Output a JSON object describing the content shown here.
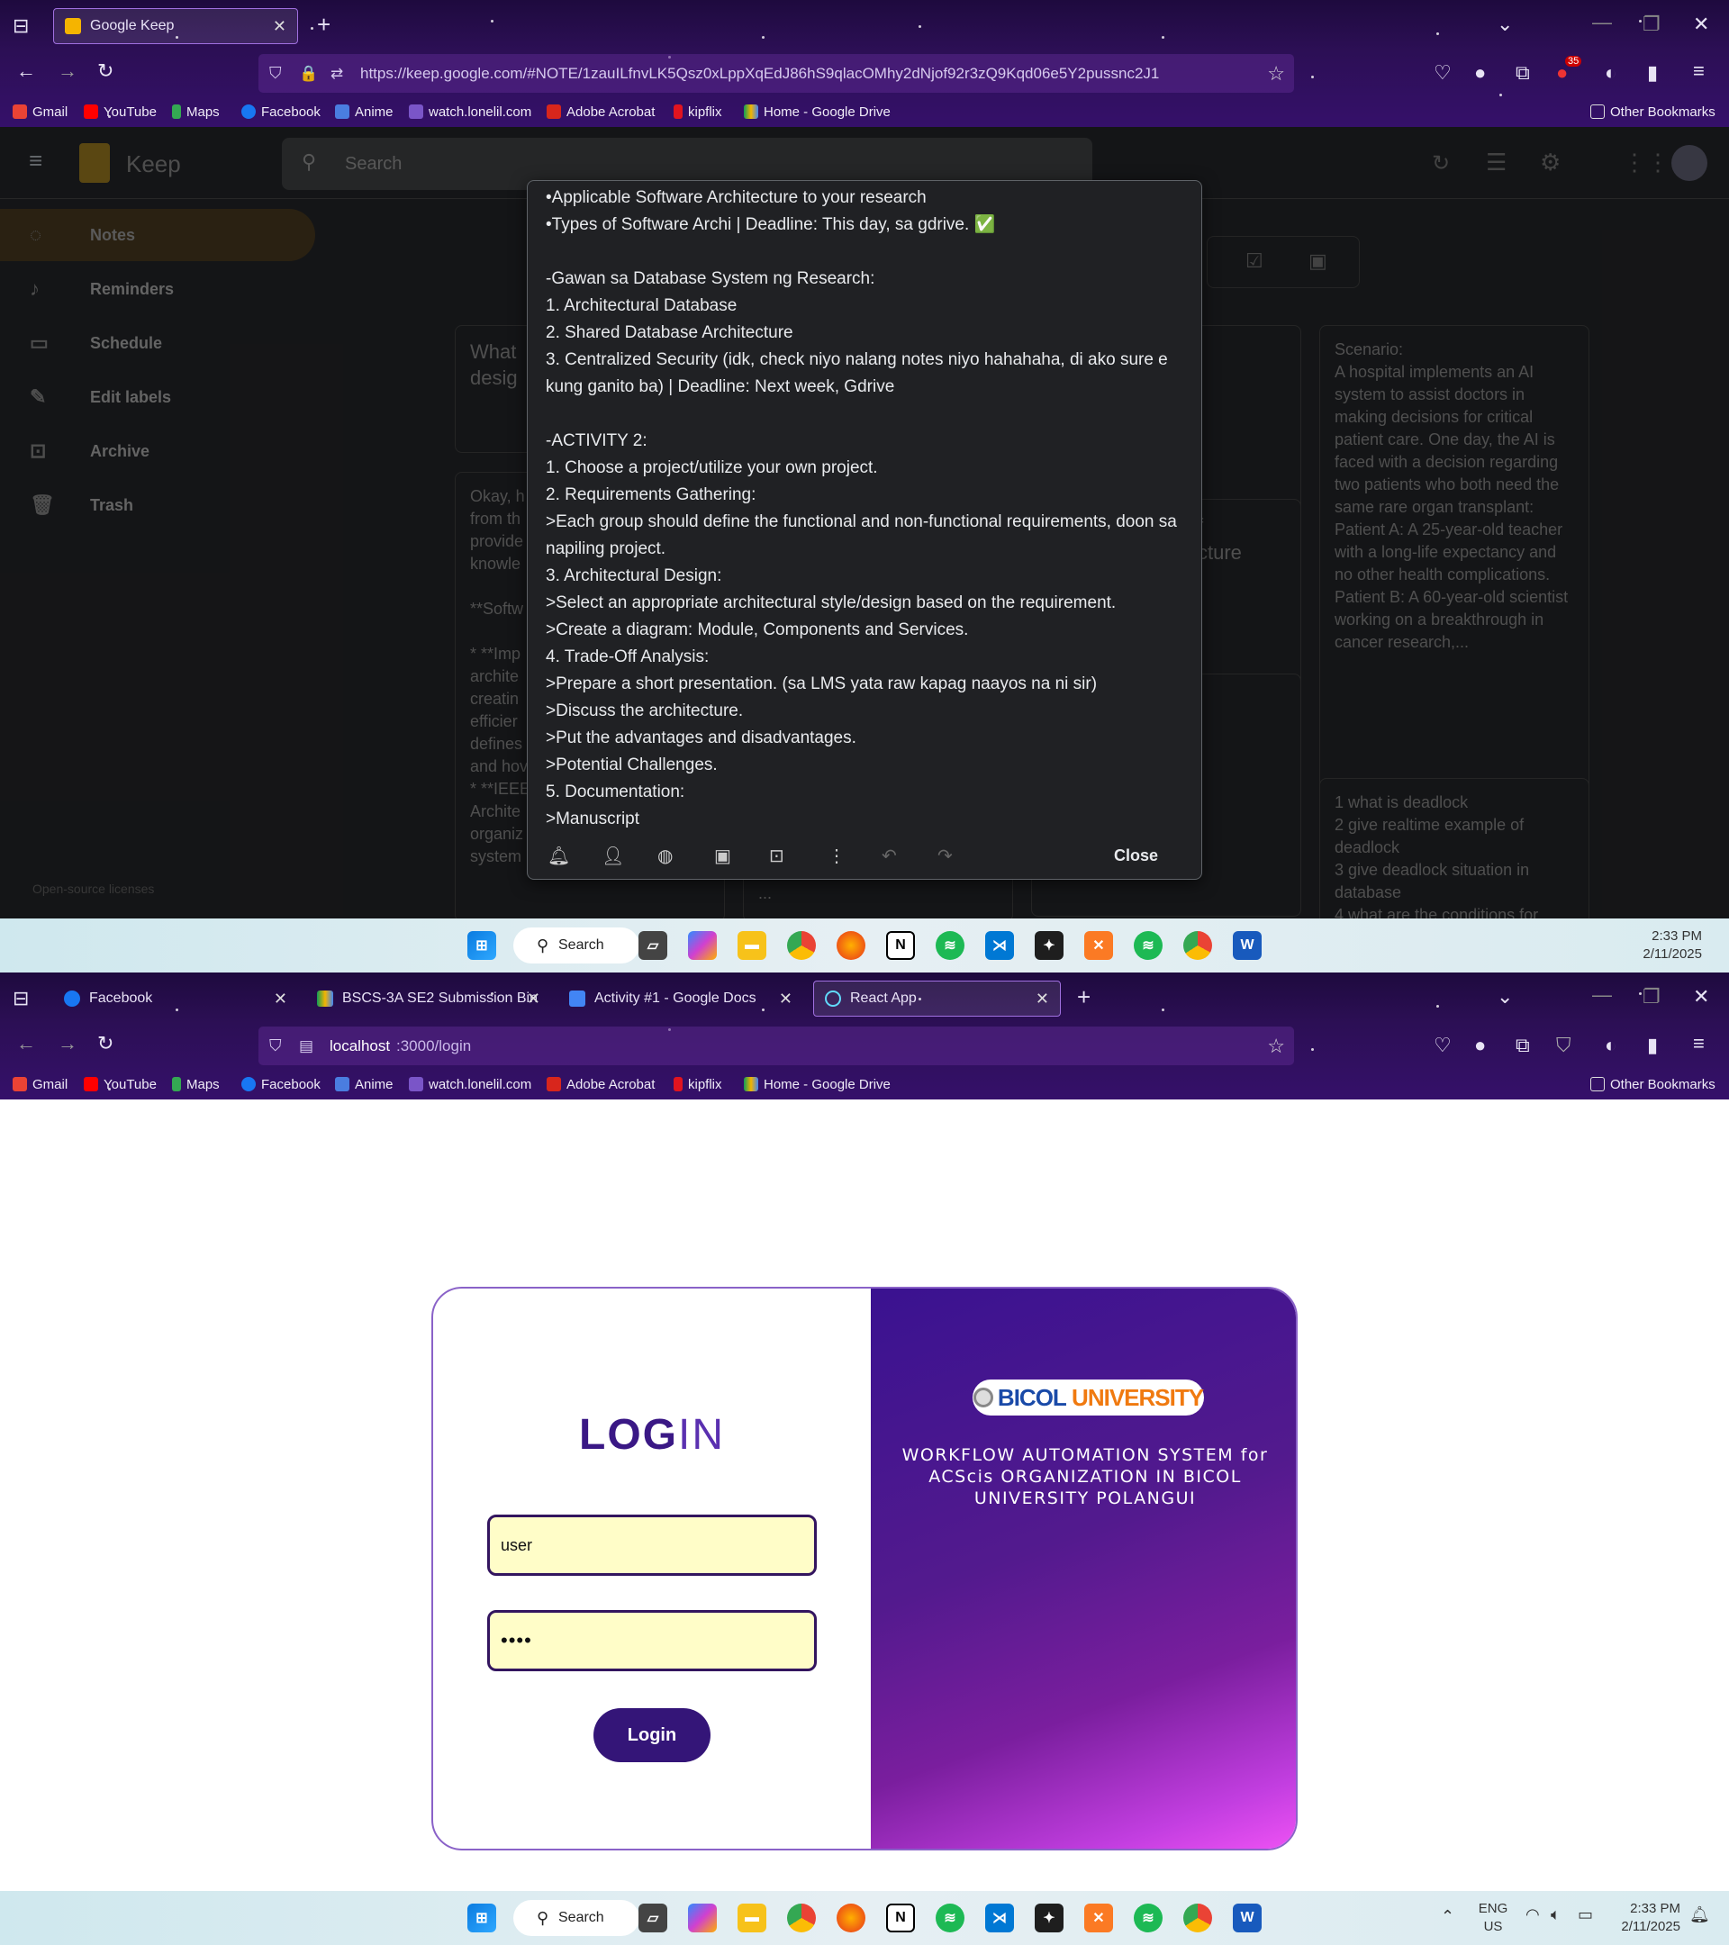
{
  "screen1": {
    "tabs": [
      {
        "title": "Google Keep"
      }
    ],
    "url": "https://keep.google.com/#NOTE/1zauILfnvLK5Qsz0xLppXqEdJ86hS9qlacOMhy2dNjof92r3zQ9Kqd06e5Y2pussnc2J1",
    "extension_badge": "35",
    "bookmarks": [
      "Gmail",
      "YouTube",
      "Maps",
      "Facebook",
      "Anime",
      "watch.lonelil.com",
      "Adobe Acrobat",
      "kipflix",
      "Home - Google Drive"
    ],
    "other_bookmarks": "Other Bookmarks",
    "keep": {
      "app_name": "Keep",
      "search_placeholder": "Search",
      "sidebar": [
        "Notes",
        "Reminders",
        "Schedule",
        "Edit labels",
        "Archive",
        "Trash"
      ],
      "footer": "Open-source licenses",
      "bg_cards": {
        "c1": "What\ndesig",
        "c2": "Okay, h\nfrom th\nprovide\nknowle\n\n**Softw\n\n* **Imp\narchite\ncreatin\nefficier\ndefines\nand hov\n* **IEEE\nArchite\norganiz\nsystem",
        "c3": "f\ncture",
        "c4": "week, Gdrive\n...",
        "c5": "Scenario:\nA hospital implements an AI system to assist doctors in making decisions for critical patient care. One day, the AI is faced with a decision regarding two patients who both need the same rare organ transplant:\nPatient A: A 25-year-old teacher with a long-life expectancy and no other health complications.\nPatient B: A 60-year-old scientist working on a breakthrough in cancer research,...",
        "c6": "1 what is deadlock\n2 give realtime example of deadlock\n3 give deadlock situation in database\n4 what are the conditions for"
      },
      "note_lines": [
        "•Applicable Software Architecture to your research",
        "•Types of Software Archi | Deadline: This day, sa gdrive. ✅",
        "",
        "-Gawan sa Database System ng Research:",
        "1. Architectural Database",
        "2. Shared Database Architecture",
        "3. Centralized Security (idk, check niyo nalang notes niyo hahahaha, di ako sure e kung ganito ba) | Deadline: Next week, Gdrive",
        "",
        "-ACTIVITY 2:",
        "1. Choose a project/utilize your own project.",
        "2. Requirements Gathering:",
        ">Each group should define the functional and non-functional requirements, doon sa napiling project.",
        "3. Architectural Design:",
        ">Select an appropriate architectural style/design based on the requirement.",
        ">Create a diagram: Module, Components and Services.",
        "4. Trade-Off Analysis:",
        ">Prepare a short presentation. (sa LMS yata raw kapag naayos na ni sir)",
        ">Discuss the architecture.",
        ">Put the advantages and disadvantages.",
        ">Potential Challenges.",
        "5. Documentation:",
        ">Manuscript"
      ],
      "close_label": "Close"
    },
    "taskbar": {
      "search": "Search",
      "time": "2:33 PM",
      "date": "2/11/2025"
    }
  },
  "screen2": {
    "tabs": [
      {
        "title": "Facebook"
      },
      {
        "title": "BSCS-3A SE2 Submission Bin - G"
      },
      {
        "title": "Activity #1 - Google Docs"
      },
      {
        "title": "React App"
      }
    ],
    "url_host": "localhost",
    "url_rest": ":3000/login",
    "bookmarks": [
      "Gmail",
      "YouTube",
      "Maps",
      "Facebook",
      "Anime",
      "watch.lonelil.com",
      "Adobe Acrobat",
      "kipflix",
      "Home - Google Drive"
    ],
    "other_bookmarks": "Other Bookmarks",
    "login": {
      "title_a": "LOG",
      "title_b": "IN",
      "username": "user",
      "password_mask": "••••",
      "button": "Login",
      "logo_text_a": "BICOL",
      "logo_text_b": "UNIVERSITY",
      "subtitle": "WORKFLOW AUTOMATION SYSTEM for ACScis ORGANIZATION IN BICOL UNIVERSITY POLANGUI"
    },
    "taskbar": {
      "search": "Search",
      "lang1": "ENG",
      "lang2": "US",
      "time": "2:33 PM",
      "date": "2/11/2025"
    }
  },
  "colors": {
    "chrome_purple": "#2c0f55",
    "login_dark": "#341578",
    "field_bg": "#fffdc8",
    "keep_bg": "#202124"
  }
}
